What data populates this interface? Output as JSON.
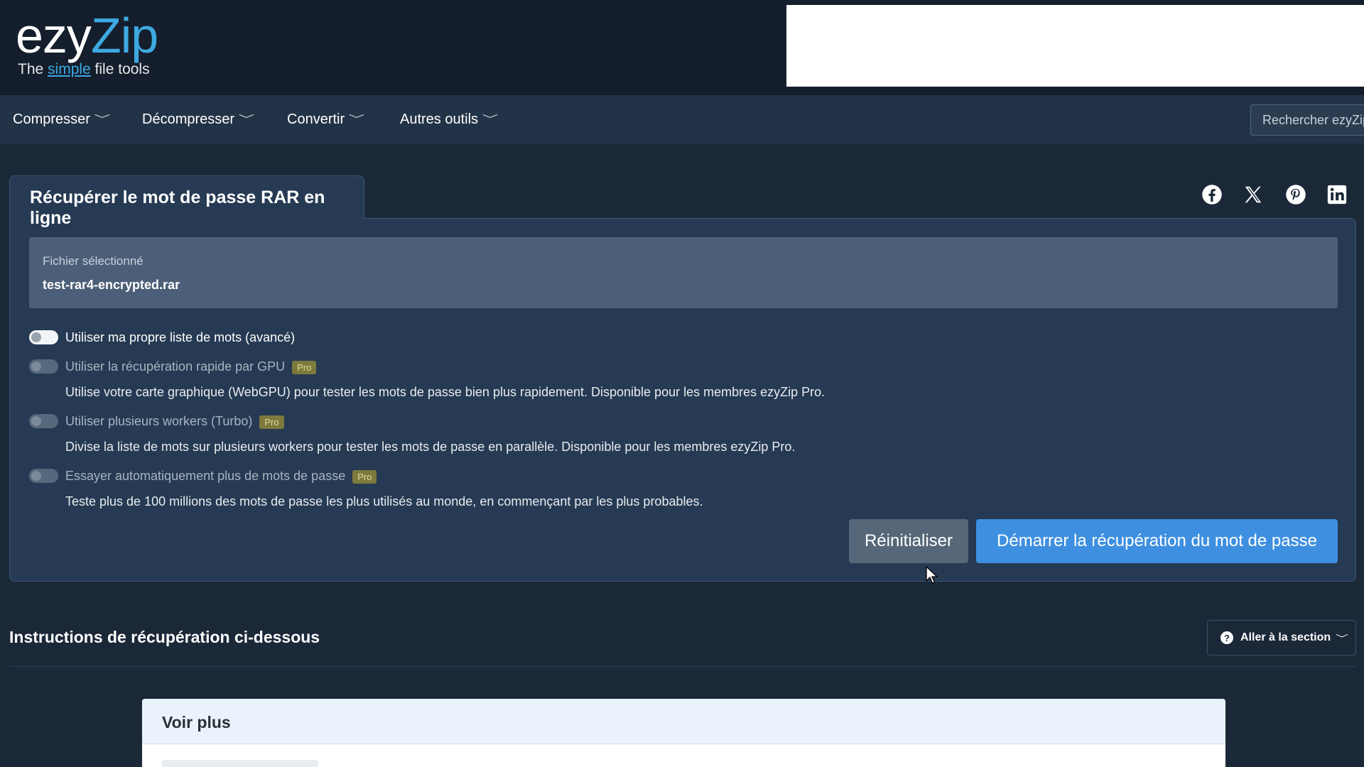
{
  "logo": {
    "brand_first": "ezy",
    "brand_second": "Zip",
    "tagline_before": "The ",
    "tagline_highlight": "simple",
    "tagline_after": " file tools"
  },
  "nav": {
    "items": [
      {
        "label": "Compresser"
      },
      {
        "label": "Décompresser"
      },
      {
        "label": "Convertir"
      },
      {
        "label": "Autres outils"
      }
    ],
    "search_placeholder": "Rechercher ezyZip"
  },
  "tool": {
    "title": "Récupérer le mot de passe RAR en ligne",
    "file_label": "Fichier sélectionné",
    "file_name": "test-rar4-encrypted.rar",
    "options": [
      {
        "label": "Utiliser ma propre liste de mots (avancé)",
        "enabled": true,
        "pro": false,
        "desc": ""
      },
      {
        "label": "Utiliser la récupération rapide par GPU",
        "enabled": false,
        "pro": true,
        "desc": "Utilise votre carte graphique (WebGPU) pour tester les mots de passe bien plus rapidement. Disponible pour les membres ezyZip Pro."
      },
      {
        "label": "Utiliser plusieurs workers (Turbo)",
        "enabled": false,
        "pro": true,
        "desc": "Divise la liste de mots sur plusieurs workers pour tester les mots de passe en parallèle. Disponible pour les membres ezyZip Pro."
      },
      {
        "label": "Essayer automatiquement plus de mots de passe",
        "enabled": false,
        "pro": true,
        "desc": "Teste plus de 100 millions des mots de passe les plus utilisés au monde, en commençant par les plus probables."
      }
    ],
    "pro_badge": "Pro",
    "reset_label": "Réinitialiser",
    "start_label": "Démarrer la récupération du mot de passe"
  },
  "social": [
    "facebook-icon",
    "x-icon",
    "pinterest-icon",
    "linkedin-icon"
  ],
  "instructions": {
    "heading": "Instructions de récupération ci-dessous",
    "goto_label": "Aller à la section"
  },
  "card": {
    "title": "Voir plus"
  },
  "colors": {
    "accent": "#3e8fe0",
    "logo_blue": "#3ea8e0",
    "background": "#1b2838",
    "panel": "#263a53"
  }
}
